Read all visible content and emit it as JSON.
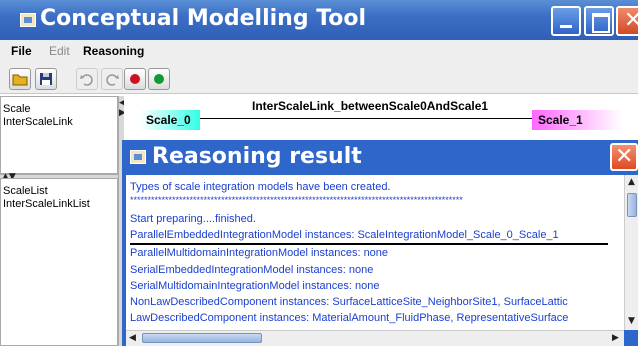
{
  "window": {
    "title": "Conceptual Modelling Tool"
  },
  "menu": {
    "file": "File",
    "edit": "Edit",
    "reasoning": "Reasoning"
  },
  "left_panel": {
    "top_items": [
      "Scale",
      "InterScaleLink"
    ],
    "bottom_items": [
      "ScaleList",
      "InterScaleLinkList"
    ]
  },
  "canvas": {
    "link_label": "InterScaleLink_betweenScale0AndScale1",
    "scale0": "Scale_0",
    "scale1": "Scale_1",
    "scale0_color": "#33ffe6",
    "scale1_color": "#ff66ff"
  },
  "dialog": {
    "title": "Reasoning result",
    "lines": [
      "Types of scale integration models have been created.",
      "***********************************************************************************************",
      "Start preparing....finished.",
      "ParallelEmbeddedIntegrationModel instances: ScaleIntegrationModel_Scale_0_Scale_1",
      "ParallelMultidomainIntegrationModel instances: none",
      "SerialEmbeddedIntegrationModel instances: none",
      "SerialMultidomainIntegrationModel instances: none",
      "NonLawDescribedComponent instances: SurfaceLatticeSite_NeighborSite1, SurfaceLattic",
      "LawDescribedComponent instances: MaterialAmount_FluidPhase, RepresentativeSurface"
    ]
  },
  "colors": {
    "title_bar": "#3c6fc4",
    "text_blue": "#1a3fd0"
  }
}
